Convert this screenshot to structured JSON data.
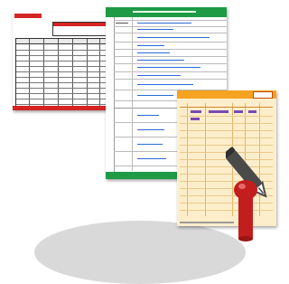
{
  "scene": {
    "colors": {
      "red_accent": "#d42424",
      "green_accent": "#1f9a45",
      "yellow_bg": "#fdeecb",
      "orange_header": "#f5a320",
      "pen_red": "#c21e1e",
      "pen_dark": "#4a4a4a"
    },
    "icons": [
      "spreadsheet-form-icon",
      "checklist-form-icon",
      "orange-form-icon",
      "pen-icon",
      "ink-pot-icon"
    ]
  }
}
